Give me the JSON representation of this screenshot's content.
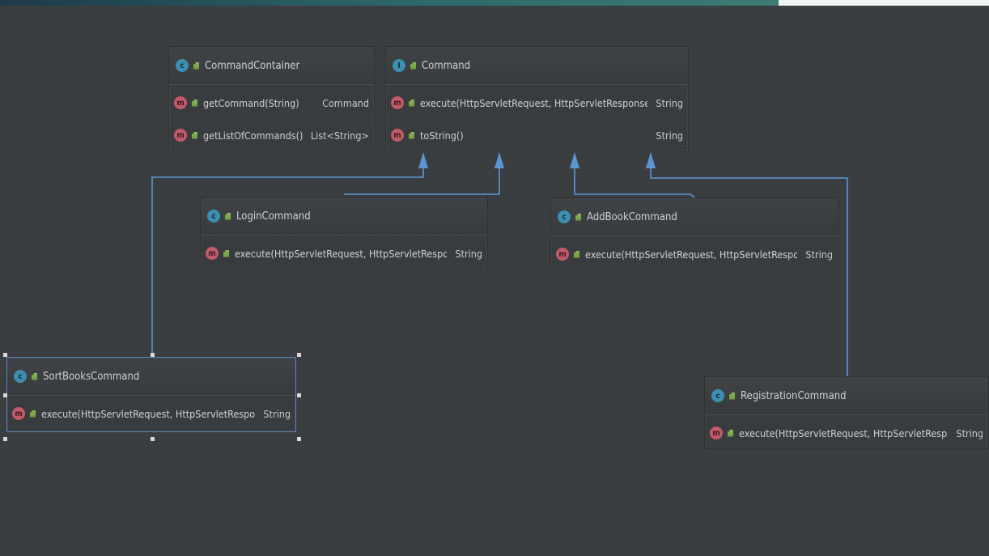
{
  "diagram": {
    "colors": {
      "background": "#3b3e41",
      "edge": "#5b95d6",
      "class_icon": "#3c8fb0",
      "method_icon": "#c25a6a"
    },
    "nodes": {
      "command_container": {
        "name": "CommandContainer",
        "members": [
          {
            "signature": "getCommand(String)",
            "return_type": "Command"
          },
          {
            "signature": "getListOfCommands()",
            "return_type": "List<String>"
          }
        ]
      },
      "command": {
        "name": "Command",
        "members": [
          {
            "signature": "execute(HttpServletRequest, HttpServletResponse)",
            "return_type": "String"
          },
          {
            "signature": "toString()",
            "return_type": "String"
          }
        ]
      },
      "login_command": {
        "name": "LoginCommand",
        "members": [
          {
            "signature": "execute(HttpServletRequest, HttpServletResponse)",
            "return_type": "String"
          }
        ]
      },
      "add_book_command": {
        "name": "AddBookCommand",
        "members": [
          {
            "signature": "execute(HttpServletRequest, HttpServletResponse)",
            "return_type": "String"
          }
        ]
      },
      "sort_books_command": {
        "name": "SortBooksCommand",
        "members": [
          {
            "signature": "execute(HttpServletRequest, HttpServletResponse)",
            "return_type": "String"
          }
        ]
      },
      "registration_command": {
        "name": "RegistrationCommand",
        "members": [
          {
            "signature": "execute(HttpServletRequest, HttpServletResponse)",
            "return_type": "String"
          }
        ]
      }
    },
    "edges": [
      {
        "from": "SortBooksCommand",
        "to": "Command",
        "type": "inheritance"
      },
      {
        "from": "LoginCommand",
        "to": "Command",
        "type": "inheritance"
      },
      {
        "from": "AddBookCommand",
        "to": "Command",
        "type": "inheritance"
      },
      {
        "from": "RegistrationCommand",
        "to": "Command",
        "type": "inheritance"
      }
    ],
    "icons": {
      "class": "c-icon",
      "method": "m-icon",
      "visibility": "public-visibility-icon"
    }
  }
}
